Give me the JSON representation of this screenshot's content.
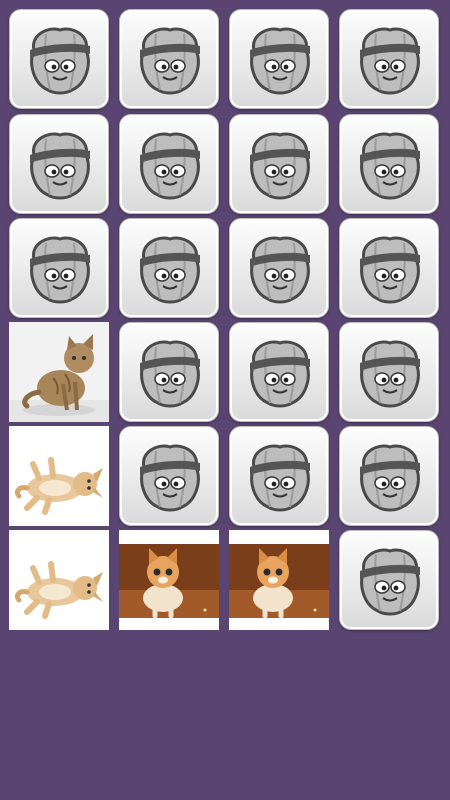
{
  "game": {
    "grid": {
      "columns": 4,
      "rows": 6
    },
    "card_back_icon": "pumpkin-headband-mascot-icon",
    "colors": {
      "background": "#5a4572",
      "card_back": "#eeeeee"
    },
    "cards": [
      {
        "state": "hidden"
      },
      {
        "state": "hidden"
      },
      {
        "state": "hidden"
      },
      {
        "state": "hidden"
      },
      {
        "state": "hidden"
      },
      {
        "state": "hidden"
      },
      {
        "state": "hidden"
      },
      {
        "state": "hidden"
      },
      {
        "state": "hidden"
      },
      {
        "state": "hidden"
      },
      {
        "state": "hidden"
      },
      {
        "state": "hidden"
      },
      {
        "state": "revealed",
        "image": "tabby-kitten-photo"
      },
      {
        "state": "hidden"
      },
      {
        "state": "hidden"
      },
      {
        "state": "hidden"
      },
      {
        "state": "revealed",
        "image": "kitten-lying-on-back-photo"
      },
      {
        "state": "hidden"
      },
      {
        "state": "hidden"
      },
      {
        "state": "hidden"
      },
      {
        "state": "revealed",
        "image": "kitten-lying-on-back-photo"
      },
      {
        "state": "revealed",
        "image": "ginger-kitten-on-floor-photo"
      },
      {
        "state": "revealed",
        "image": "ginger-kitten-on-floor-photo"
      },
      {
        "state": "hidden"
      }
    ]
  }
}
